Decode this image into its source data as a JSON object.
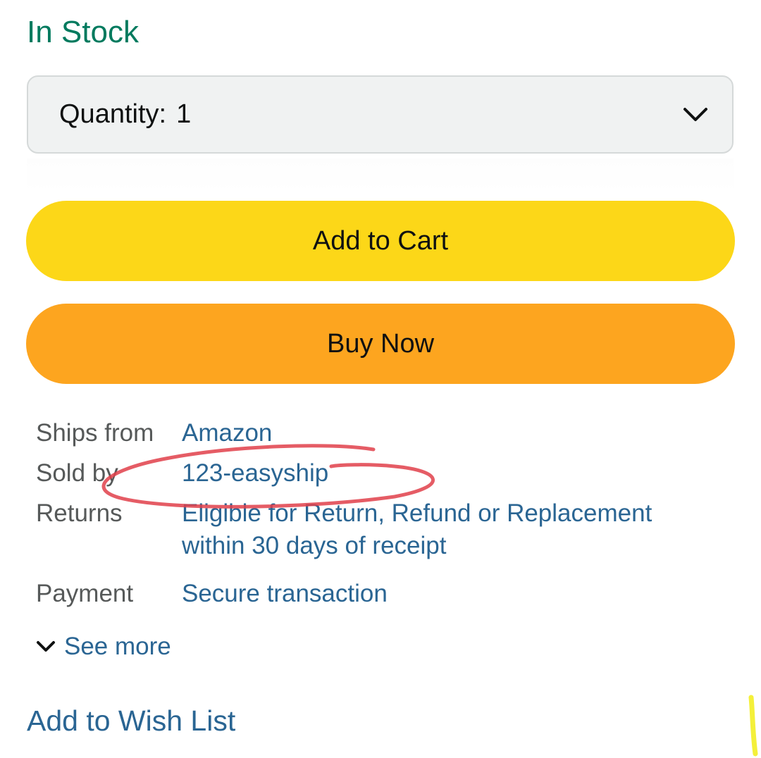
{
  "availability": {
    "text": "In Stock",
    "color": "#007a5e"
  },
  "quantity": {
    "label": "Quantity:",
    "value": "1",
    "icon": "chevron-down-icon"
  },
  "buttons": {
    "add_to_cart": "Add to Cart",
    "buy_now": "Buy Now",
    "add_to_cart_color": "#fcd718",
    "buy_now_color": "#fda51f"
  },
  "details": {
    "ships_from": {
      "label": "Ships from",
      "value": "Amazon"
    },
    "sold_by": {
      "label": "Sold by",
      "value": "123-easyship"
    },
    "returns": {
      "label": "Returns",
      "value": "Eligible for Return, Refund or Replacement within 30 days of receipt"
    },
    "payment": {
      "label": "Payment",
      "value": "Secure transaction"
    }
  },
  "see_more": "See more",
  "wish_list": "Add to Wish List",
  "colors": {
    "link": "#2a6593",
    "annotation_red": "#e0404a",
    "annotation_yellow": "#f4f03a"
  }
}
